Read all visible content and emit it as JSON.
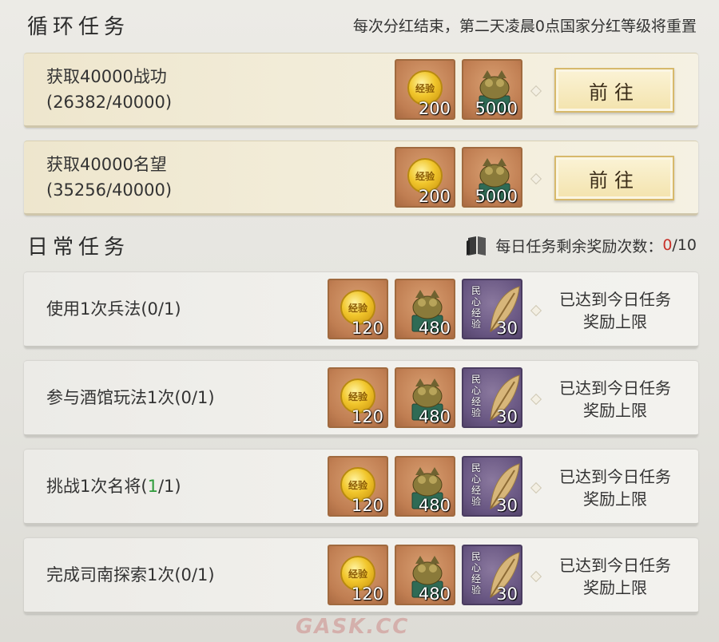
{
  "loop_section": {
    "title": "循环任务",
    "note": "每次分红结束，第二天凌晨0点国家分红等级将重置",
    "tasks": [
      {
        "name": "获取40000战功",
        "progress": "(26382/40000)",
        "rewards": [
          {
            "icon": "exp-coin-icon",
            "coin_text": "经验",
            "qty": "200"
          },
          {
            "icon": "dragon-seal-icon",
            "qty": "5000"
          }
        ],
        "button_label": "前往"
      },
      {
        "name": "获取40000名望",
        "progress": "(35256/40000)",
        "rewards": [
          {
            "icon": "exp-coin-icon",
            "coin_text": "经验",
            "qty": "200"
          },
          {
            "icon": "dragon-seal-icon",
            "qty": "5000"
          }
        ],
        "button_label": "前往"
      }
    ]
  },
  "daily_section": {
    "title": "日常任务",
    "note_label": "每日任务剩余奖励次数：",
    "note_count": "0",
    "note_total": "/10",
    "tasks": [
      {
        "name": "使用1次兵法(0/1)",
        "rewards": [
          {
            "icon": "exp-coin-icon",
            "coin_text": "经验",
            "qty": "120"
          },
          {
            "icon": "dragon-seal-icon",
            "qty": "480"
          },
          {
            "icon": "feather-icon",
            "label": "民心经验",
            "qty": "30"
          }
        ],
        "limit_line1": "已达到今日任务",
        "limit_line2": "奖励上限"
      },
      {
        "name": "参与酒馆玩法1次(0/1)",
        "rewards": [
          {
            "icon": "exp-coin-icon",
            "coin_text": "经验",
            "qty": "120"
          },
          {
            "icon": "dragon-seal-icon",
            "qty": "480"
          },
          {
            "icon": "feather-icon",
            "label": "民心经验",
            "qty": "30"
          }
        ],
        "limit_line1": "已达到今日任务",
        "limit_line2": "奖励上限"
      },
      {
        "name_prefix": "挑战1次名将(",
        "name_done": "1",
        "name_suffix": "/1)",
        "rewards": [
          {
            "icon": "exp-coin-icon",
            "coin_text": "经验",
            "qty": "120"
          },
          {
            "icon": "dragon-seal-icon",
            "qty": "480"
          },
          {
            "icon": "feather-icon",
            "label": "民心经验",
            "qty": "30"
          }
        ],
        "limit_line1": "已达到今日任务",
        "limit_line2": "奖励上限"
      },
      {
        "name": "完成司南探索1次(0/1)",
        "rewards": [
          {
            "icon": "exp-coin-icon",
            "coin_text": "经验",
            "qty": "120"
          },
          {
            "icon": "dragon-seal-icon",
            "qty": "480"
          },
          {
            "icon": "feather-icon",
            "label": "民心经验",
            "qty": "30"
          }
        ],
        "limit_line1": "已达到今日任务",
        "limit_line2": "奖励上限"
      }
    ]
  },
  "watermark": "GASK.CC",
  "colors": {
    "count_zero": "#c8322a",
    "count_done": "#2e9b3a",
    "button_gold": "#f3e3ad"
  }
}
